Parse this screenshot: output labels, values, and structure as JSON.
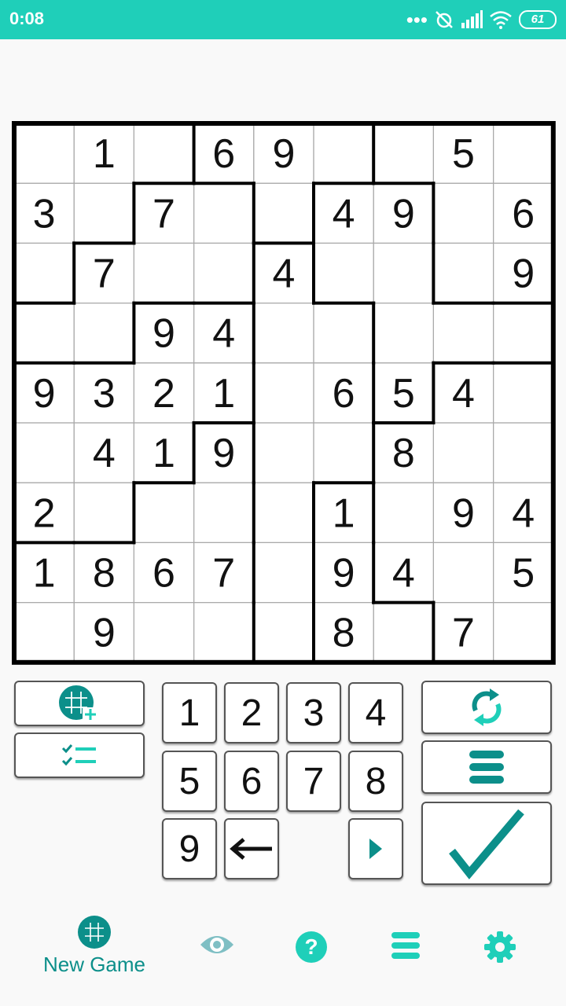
{
  "status_bar": {
    "time": "0:08",
    "battery": "61"
  },
  "puzzle": {
    "values": [
      [
        0,
        1,
        0,
        6,
        9,
        0,
        0,
        5,
        0
      ],
      [
        3,
        0,
        7,
        0,
        0,
        4,
        9,
        0,
        6
      ],
      [
        0,
        7,
        0,
        0,
        4,
        0,
        0,
        0,
        9
      ],
      [
        0,
        0,
        9,
        4,
        0,
        0,
        0,
        0,
        0
      ],
      [
        9,
        3,
        2,
        1,
        0,
        6,
        5,
        4,
        0
      ],
      [
        0,
        4,
        1,
        9,
        0,
        0,
        8,
        0,
        0
      ],
      [
        2,
        0,
        0,
        0,
        0,
        1,
        0,
        9,
        4
      ],
      [
        1,
        8,
        6,
        7,
        0,
        9,
        4,
        0,
        5
      ],
      [
        0,
        9,
        0,
        0,
        0,
        8,
        0,
        7,
        0
      ]
    ],
    "regions": [
      "000111222",
      "003314422",
      "033354422",
      "336655444",
      "666655477",
      "666855777",
      "668858777",
      "888858777",
      "888858877"
    ]
  },
  "keypad": {
    "numbers": [
      "1",
      "2",
      "3",
      "4",
      "5",
      "6",
      "7",
      "8",
      "9"
    ],
    "backspace_symbol": "←",
    "next_symbol": "▶"
  },
  "left_tools": {
    "new_grid_icon": "grid-plus-icon",
    "checklist_icon": "checklist-icon"
  },
  "right_tools": {
    "refresh_icon": "refresh-icon",
    "menu_icon": "menu-icon",
    "check_icon": "checkmark-icon"
  },
  "nav": {
    "new_game_label": "New Game"
  },
  "colors": {
    "accent": "#1fcfb9",
    "teal_dark": "#0c8f8a",
    "grid_line": "#aaaaaa",
    "thick_line": "#000000"
  }
}
